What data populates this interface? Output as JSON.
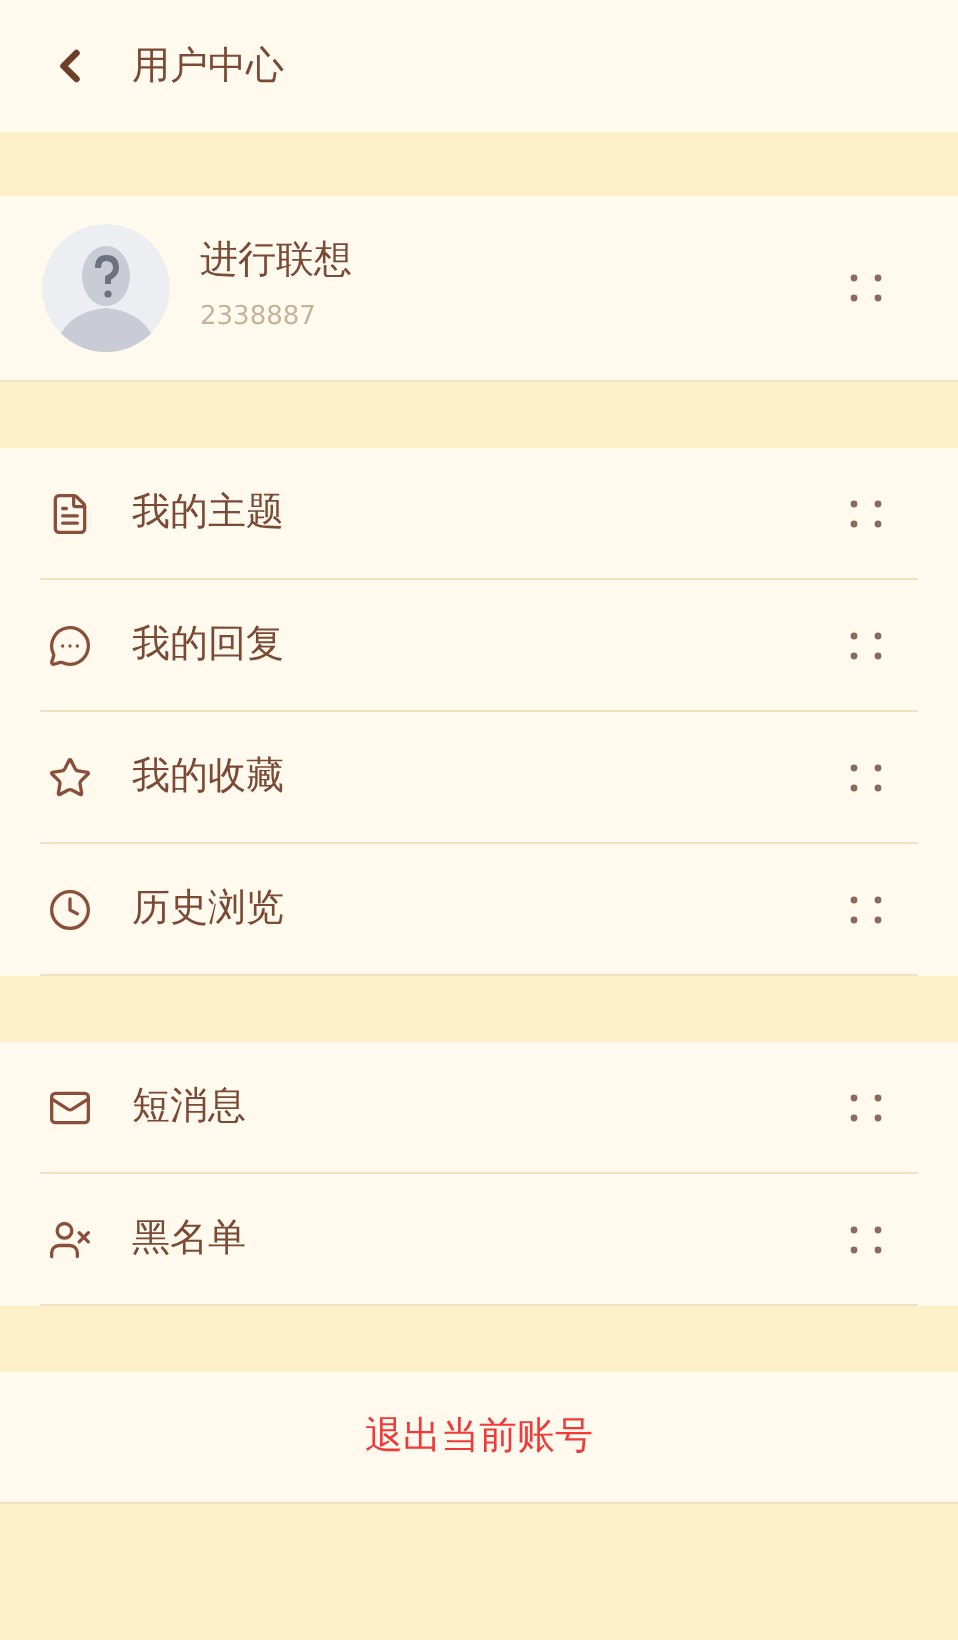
{
  "header": {
    "title": "用户中心"
  },
  "profile": {
    "name": "进行联想",
    "id": "2338887"
  },
  "menu_groups": [
    [
      {
        "kind": "document",
        "label": "我的主题"
      },
      {
        "kind": "comment",
        "label": "我的回复"
      },
      {
        "kind": "favorite",
        "label": "我的收藏"
      },
      {
        "kind": "history",
        "label": "历史浏览"
      }
    ],
    [
      {
        "kind": "message",
        "label": "短消息"
      },
      {
        "kind": "blacklist",
        "label": "黑名单"
      }
    ]
  ],
  "logout": {
    "label": "退出当前账号"
  }
}
